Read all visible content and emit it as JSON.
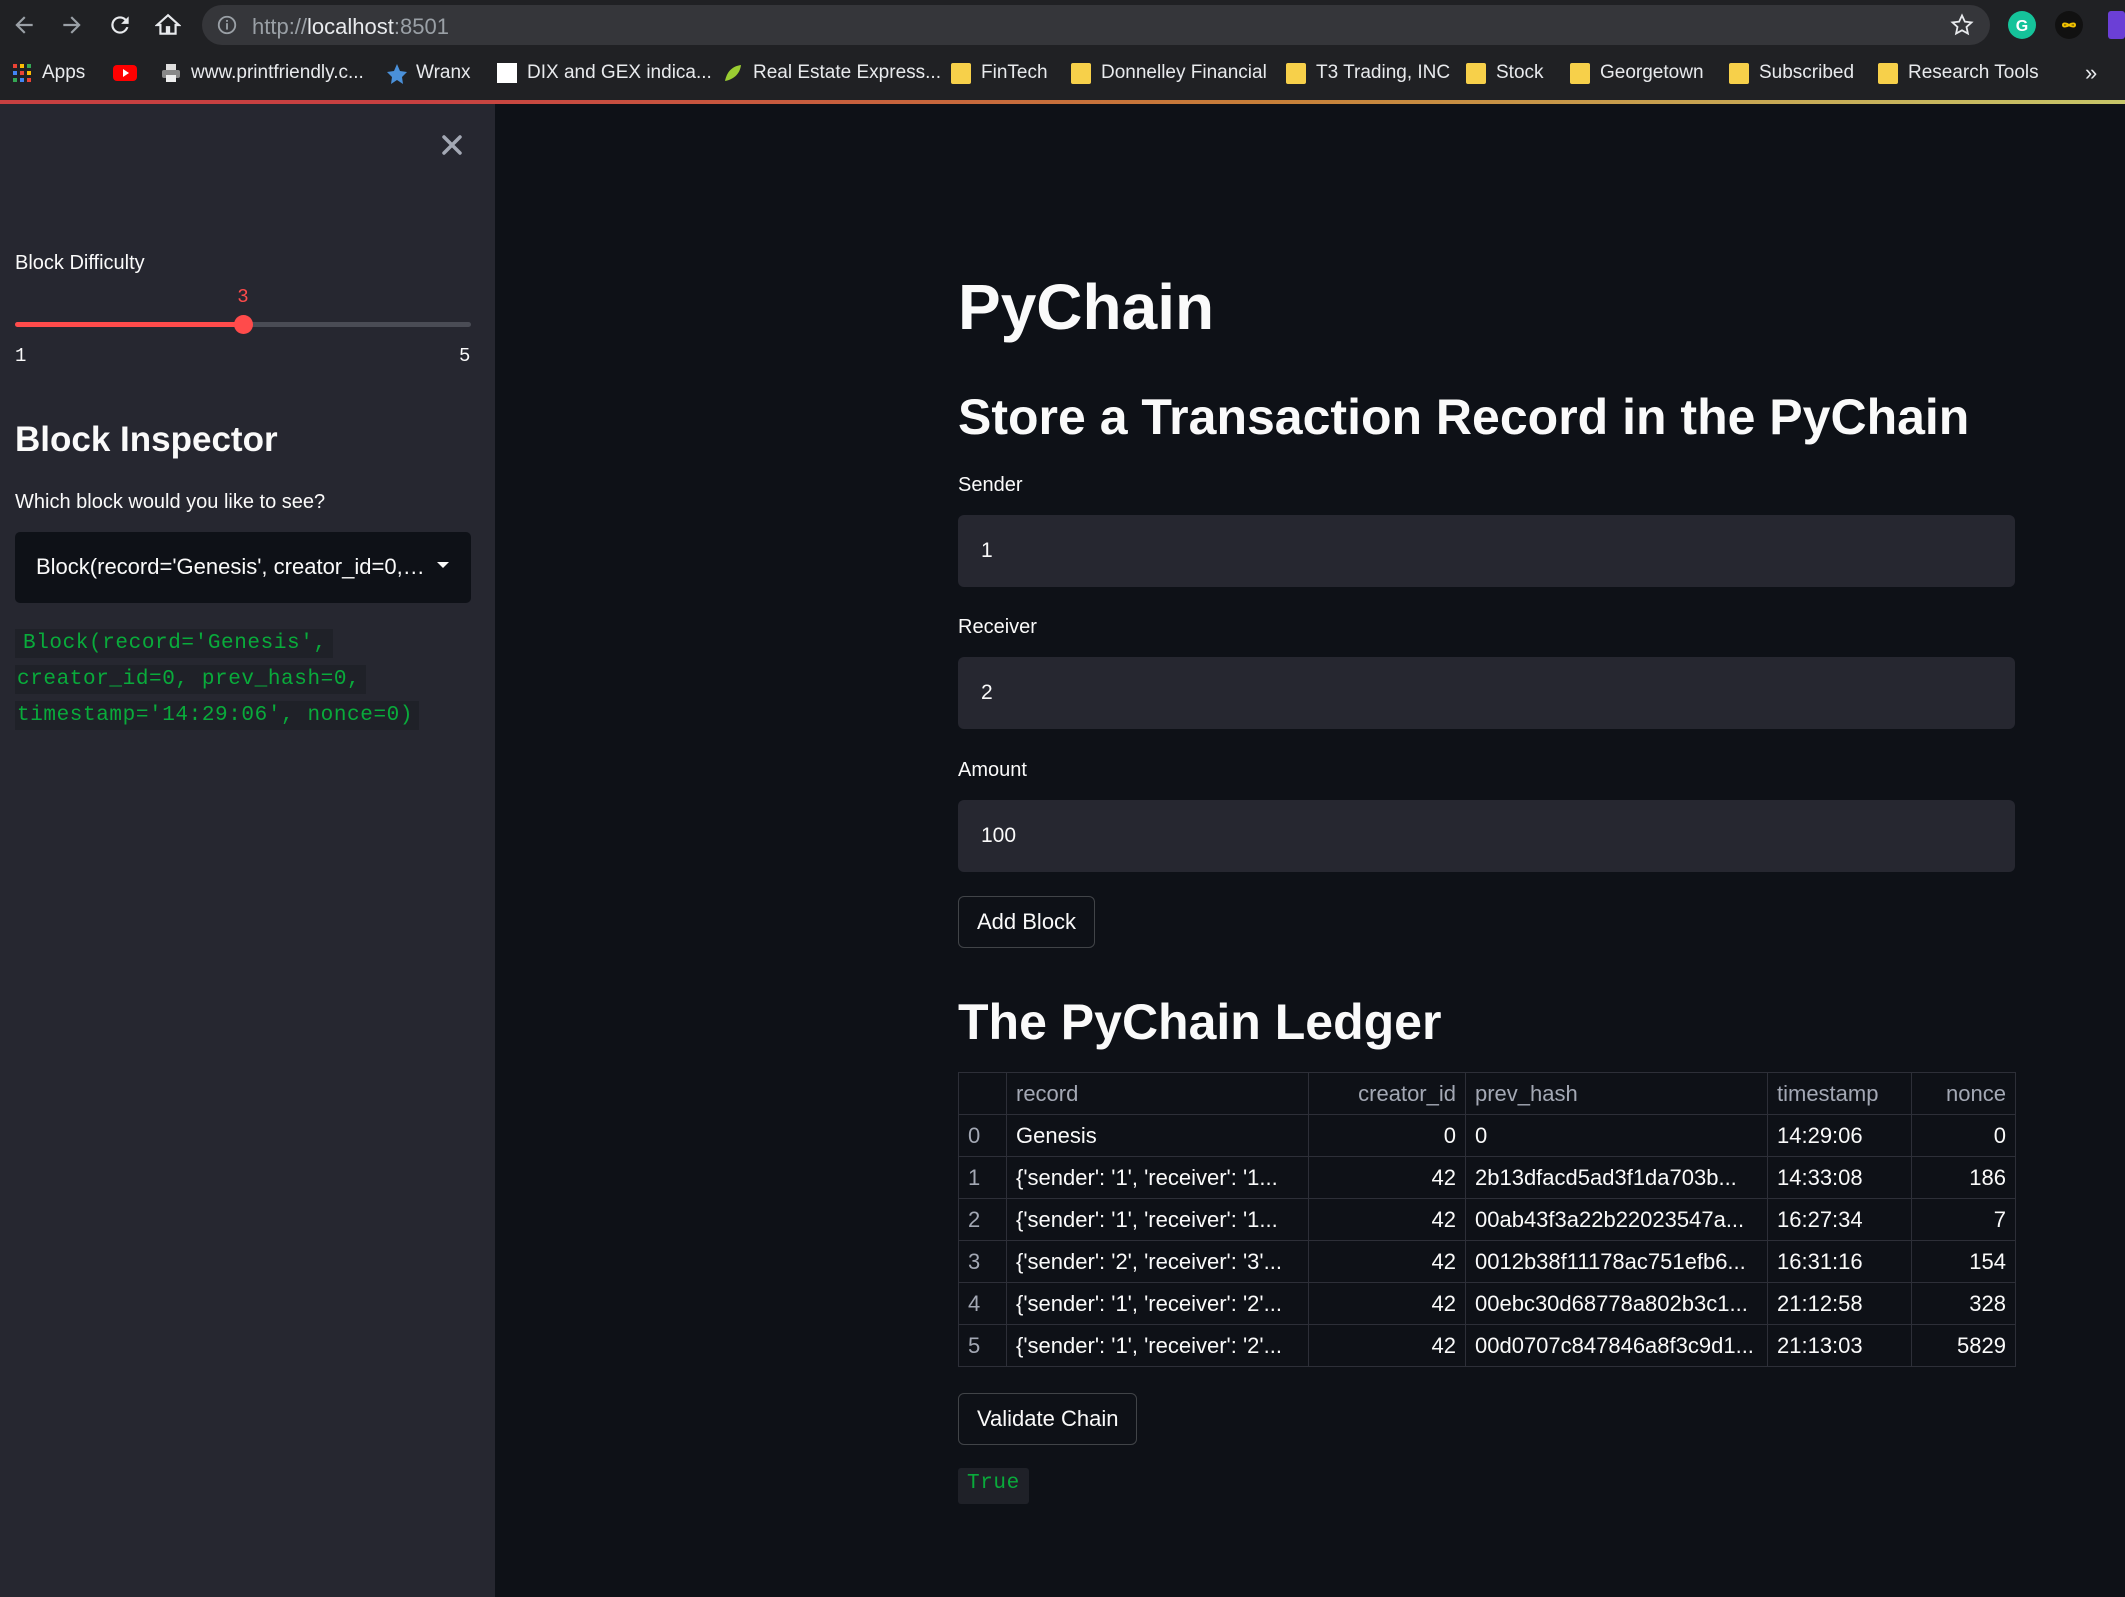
{
  "browser": {
    "url_scheme": "http://",
    "url_host": "localhost",
    "url_port": ":8501",
    "bookmarks": [
      {
        "label": "Apps"
      },
      {
        "label": ""
      },
      {
        "label": "www.printfriendly.c..."
      },
      {
        "label": "Wranx"
      },
      {
        "label": "DIX and GEX indica..."
      },
      {
        "label": "Real Estate Express..."
      },
      {
        "label": "FinTech"
      },
      {
        "label": "Donnelley Financial"
      },
      {
        "label": "T3 Trading, INC"
      },
      {
        "label": "Stock"
      },
      {
        "label": "Georgetown"
      },
      {
        "label": "Subscribed"
      },
      {
        "label": "Research Tools"
      }
    ],
    "more_label": "»"
  },
  "sidebar": {
    "difficulty_label": "Block Difficulty",
    "difficulty_value": "3",
    "difficulty_min": "1",
    "difficulty_max": "5",
    "difficulty_fraction": 0.5,
    "inspector_title": "Block Inspector",
    "inspector_question": "Which block would you like to see?",
    "selected_block": "Block(record='Genesis', creator_id=0, prev_hash=0, timestamp='14:29:06', nonce=0)",
    "code_lines": [
      "Block(record='Genesis',",
      "creator_id=0, prev_hash=0,",
      "timestamp='14:29:06', nonce=0)"
    ]
  },
  "main": {
    "title": "PyChain",
    "subtitle": "Store a Transaction Record in the PyChain",
    "sender_label": "Sender",
    "sender_value": "1",
    "receiver_label": "Receiver",
    "receiver_value": "2",
    "amount_label": "Amount",
    "amount_value": "100",
    "add_block_label": "Add Block",
    "ledger_title": "The PyChain Ledger",
    "ledger": {
      "columns": [
        "",
        "record",
        "creator_id",
        "prev_hash",
        "timestamp",
        "nonce"
      ],
      "rows": [
        [
          "0",
          "Genesis",
          "0",
          "0",
          "14:29:06",
          "0"
        ],
        [
          "1",
          "{'sender': '1', 'receiver': '1...",
          "42",
          "2b13dfacd5ad3f1da703b...",
          "14:33:08",
          "186"
        ],
        [
          "2",
          "{'sender': '1', 'receiver': '1...",
          "42",
          "00ab43f3a22b22023547a...",
          "16:27:34",
          "7"
        ],
        [
          "3",
          "{'sender': '2', 'receiver': '3'...",
          "42",
          "0012b38f11178ac751efb6...",
          "16:31:16",
          "154"
        ],
        [
          "4",
          "{'sender': '1', 'receiver': '2'...",
          "42",
          "00ebc30d68778a802b3c1...",
          "21:12:58",
          "328"
        ],
        [
          "5",
          "{'sender': '1', 'receiver': '2'...",
          "42",
          "00d0707c847846a8f3c9d1...",
          "21:13:03",
          "5829"
        ]
      ]
    },
    "validate_label": "Validate Chain",
    "validation_result": "True"
  },
  "colors": {
    "accent": "#ff4b4b",
    "success_text": "#09ab3b",
    "sidebar_bg": "#262730",
    "main_bg": "#0e1117"
  }
}
